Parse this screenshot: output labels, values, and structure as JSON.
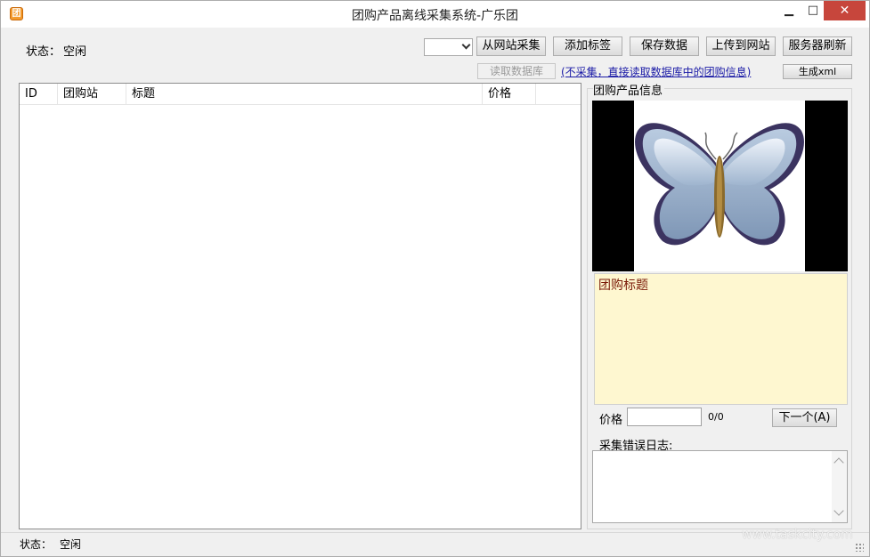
{
  "window": {
    "title": "团购产品离线采集系统-广乐团",
    "icon_char": "团",
    "minimize_glyph": "▁",
    "maximize_glyph": "□",
    "close_glyph": "✕"
  },
  "top_status": {
    "label": "状态：",
    "value": "空闲"
  },
  "source_select": {
    "value": ""
  },
  "toolbar": {
    "collect_label": "从网站采集",
    "add_tag_label": "添加标签",
    "save_label": "保存数据",
    "upload_label": "上传到网站",
    "refresh_label": "服务器刷新",
    "read_db_label": "读取数据库",
    "read_db_note": "(不采集，直接读取数据库中的团购信息)",
    "gen_xml_label": "生成xml"
  },
  "list": {
    "columns": [
      "ID",
      "团购站",
      "标题",
      "价格"
    ]
  },
  "product": {
    "group_title": "团购产品信息",
    "title_placeholder": "团购标题",
    "price_label": "价格",
    "price_value": "",
    "count_text": "0/0",
    "next_label": "下一个(A)"
  },
  "log": {
    "label": "采集错误日志:"
  },
  "statusbar": {
    "label": "状态：",
    "value": "空闲"
  },
  "watermark": "www.taskcity.com"
}
